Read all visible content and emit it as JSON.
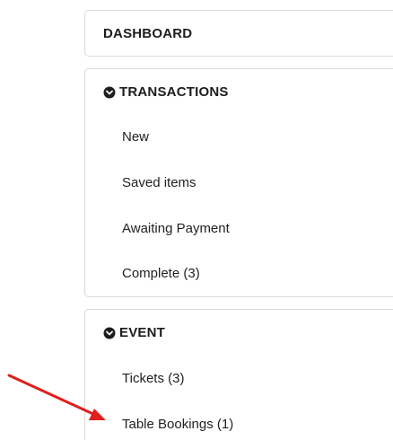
{
  "colors": {
    "arrow": "#e0201c",
    "border": "#d9d9d9",
    "text": "#222222"
  },
  "nav": {
    "dashboard": {
      "label": "DASHBOARD"
    },
    "transactions": {
      "label": "TRANSACTIONS",
      "icon": "chevron-down-circle-icon",
      "items": [
        {
          "label": "New"
        },
        {
          "label": "Saved items"
        },
        {
          "label": "Awaiting Payment"
        },
        {
          "label": "Complete (3)"
        }
      ]
    },
    "event": {
      "label": "EVENT",
      "icon": "chevron-down-circle-icon",
      "items": [
        {
          "label": "Tickets (3)"
        },
        {
          "label": "Table Bookings (1)"
        }
      ]
    }
  }
}
